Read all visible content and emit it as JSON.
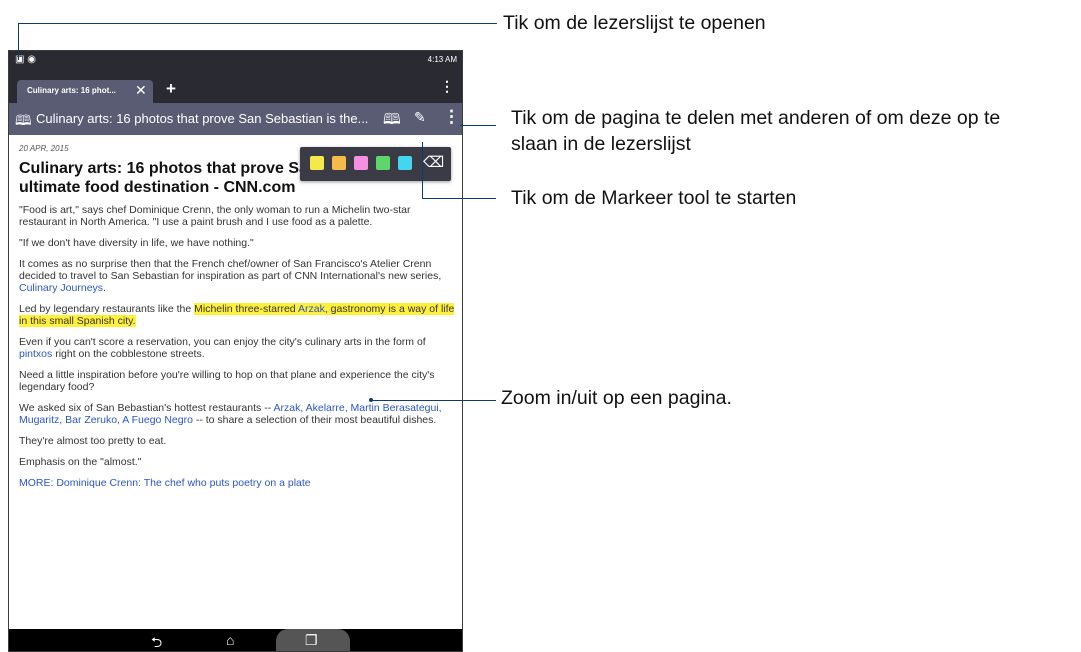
{
  "status_bar": {
    "time": "4:13 AM"
  },
  "tabs": [
    {
      "label": "Culinary arts: 16 phot...",
      "close": "✕"
    }
  ],
  "new_tab_label": "+",
  "url_bar": {
    "title": "Culinary arts: 16 photos that prove San Sebastian is the..."
  },
  "article": {
    "date": "20 APR, 2015",
    "headline_line1": "Culinary arts: 16 photos that prove Sa",
    "headline_line2": "ultimate food destination - CNN.com",
    "p1": "\"Food is art,\" says chef Dominique Crenn, the only woman to run a Michelin two-star restaurant in North America. \"I use a paint brush and I use food as a palette.",
    "p2": "\"If we don't have diversity in life, we have nothing.\"",
    "p3_text": "It comes as no surprise then that the French chef/owner of San Francisco's Atelier Crenn decided to travel to San Sebastian for inspiration as part of CNN International's new series, ",
    "p3_link": "Culinary Journeys",
    "p3_end": ".",
    "p4_text": "Led by legendary restaurants like the ",
    "p4_hl1": "Michelin three-starred ",
    "p4_link": "Arzak",
    "p4_hl2": ", gastronomy is a way of life in this small Spanish city.",
    "p5_text": "Even if you can't score a reservation, you can enjoy the city's culinary arts in the form of ",
    "p5_link": "pintxos",
    "p5_end": " right on the cobblestone streets.",
    "p6": "Need a little inspiration before you're willing to hop on that plane and experience the city's legendary food?",
    "p7_text": "We asked six of San Bebastian's hottest restaurants -- ",
    "p7_links": "Arzak, Akelarre, Martin Berasategui, Mugaritz, Bar Zeruko, A Fuego Negro",
    "p7_end": " -- to share a selection of their most beautiful dishes.",
    "p8": "They're almost too pretty to eat.",
    "p9": "Emphasis on the \"almost.\"",
    "p10": "MORE: Dominique Crenn: The chef who puts poetry on a plate"
  },
  "highlighter_colors": [
    "#f4e94a",
    "#f6b94c",
    "#f58fe0",
    "#5fd66b",
    "#44d6ee"
  ],
  "callouts": {
    "reading_list": "Tik om de lezerslijst te openen",
    "share_line1": "Tik om de pagina te delen met anderen of om deze op te",
    "share_line2": "slaan in de lezerslijst",
    "marker": "Tik om de Markeer tool te starten",
    "zoom": "Zoom in/uit op een pagina."
  }
}
